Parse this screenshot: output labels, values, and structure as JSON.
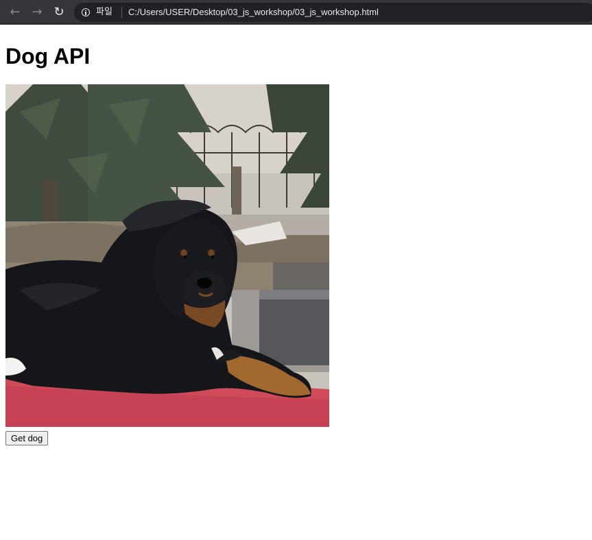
{
  "browser": {
    "scheme_label": "파일",
    "url": "C:/Users/USER/Desktop/03_js_workshop/03_js_workshop.html"
  },
  "page": {
    "title": "Dog API",
    "image_subject": "black Tibetan Mastiff dog lying on a red mat in front of evergreen trees",
    "button_label": "Get dog"
  }
}
